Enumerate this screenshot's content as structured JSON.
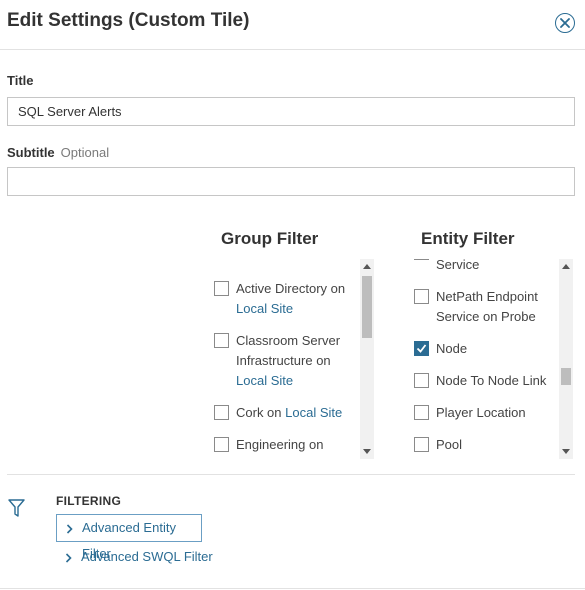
{
  "dialog": {
    "title": "Edit Settings (Custom Tile)"
  },
  "title_field": {
    "label": "Title",
    "value": "SQL Server Alerts"
  },
  "subtitle_field": {
    "label": "Subtitle",
    "hint": "Optional",
    "value": ""
  },
  "group_filter": {
    "heading": "Group Filter",
    "items": [
      {
        "text": "Active Directory on",
        "link": "Local Site",
        "checked": false
      },
      {
        "text": "Classroom Server Infrastructure on",
        "link": "Local Site",
        "checked": false
      },
      {
        "text": "Cork on",
        "link": "Local Site",
        "checked": false
      },
      {
        "text": "Engineering on",
        "link": "",
        "checked": false
      }
    ]
  },
  "entity_filter": {
    "heading": "Entity Filter",
    "items": [
      {
        "text": "Service",
        "checked": false
      },
      {
        "text": "NetPath Endpoint Service on Probe",
        "checked": false
      },
      {
        "text": "Node",
        "checked": true
      },
      {
        "text": "Node To Node Link",
        "checked": false
      },
      {
        "text": "Player Location",
        "checked": false
      },
      {
        "text": "Pool",
        "checked": false
      }
    ]
  },
  "filtering": {
    "label": "FILTERING",
    "advanced_entity": "Advanced Entity Filter",
    "advanced_swql": "Advanced SWQL Filter"
  },
  "colors": {
    "accent": "#2b6c93",
    "checked": "#2b6c93"
  },
  "icons": [
    "close-circle-icon",
    "filter-funnel-icon",
    "chevron-right-icon",
    "checkmark-icon"
  ]
}
